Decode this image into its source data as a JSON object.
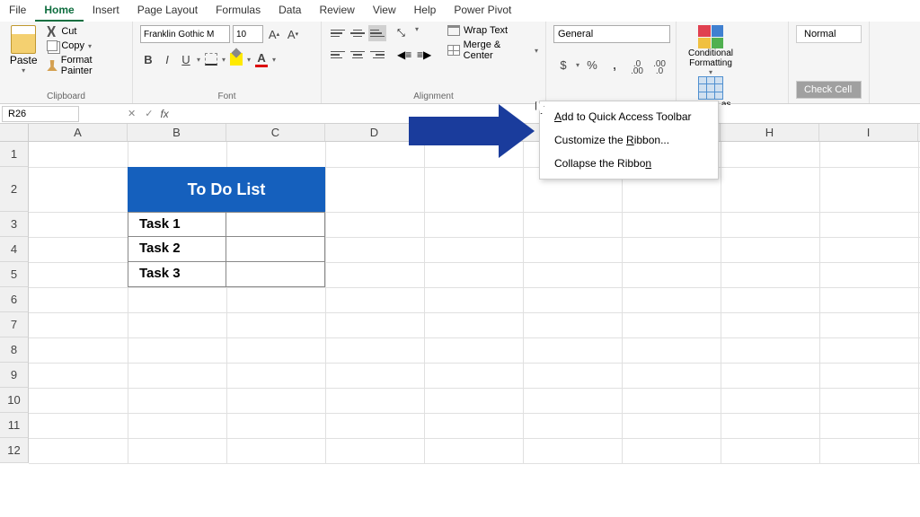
{
  "menubar": [
    "File",
    "Home",
    "Insert",
    "Page Layout",
    "Formulas",
    "Data",
    "Review",
    "View",
    "Help",
    "Power Pivot"
  ],
  "active_tab": "Home",
  "clipboard": {
    "paste": "Paste",
    "cut": "Cut",
    "copy": "Copy",
    "painter": "Format Painter",
    "label": "Clipboard"
  },
  "font": {
    "name": "Franklin Gothic M",
    "size": "10",
    "label": "Font"
  },
  "alignment": {
    "wrap": "Wrap Text",
    "merge": "Merge & Center",
    "label": "Alignment"
  },
  "number": {
    "format": "General"
  },
  "styles": {
    "conditional": "Conditional Formatting",
    "table": "Format as Table",
    "normal": "Normal",
    "check": "Check Cell"
  },
  "namebox": "R26",
  "columns": [
    "A",
    "B",
    "C",
    "D",
    "E",
    "F",
    "G",
    "H",
    "I"
  ],
  "rows": [
    "1",
    "2",
    "3",
    "4",
    "5",
    "6",
    "7",
    "8",
    "9",
    "10",
    "11",
    "12"
  ],
  "todo": {
    "header": "To Do List",
    "tasks": [
      "Task 1",
      "Task 2",
      "Task 3"
    ]
  },
  "context_menu": {
    "add": {
      "pre": "",
      "u": "A",
      "post": "dd to Quick Access Toolbar"
    },
    "customize": {
      "pre": "Customize the ",
      "u": "R",
      "post": "ibbon..."
    },
    "collapse": {
      "pre": "Collapse the Ribbo",
      "u": "n",
      "post": ""
    }
  }
}
